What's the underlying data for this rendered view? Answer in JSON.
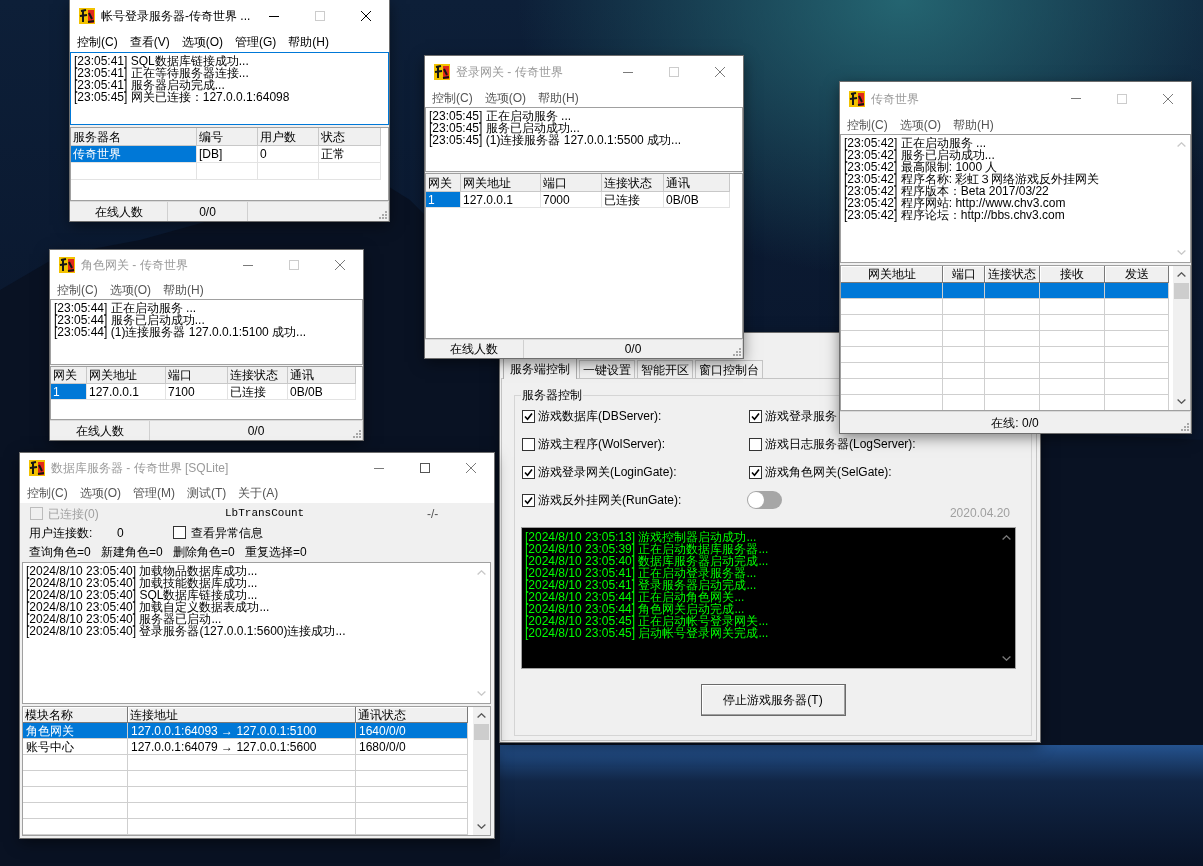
{
  "windows": [
    {
      "kind": "list_window",
      "title": "帐号登录服务器-传奇世界 ...",
      "active": true,
      "maximize_disabled": true,
      "menu": [
        "控制(C)",
        "查看(V)",
        "选项(O)",
        "管理(G)",
        "帮助(H)"
      ],
      "log_focused": true,
      "log": [
        "[23:05:41] SQL数据库链接成功...",
        "[23:05:41] 正在等待服务器连接...",
        "[23:05:41] 服务器启动完成...",
        "[23:05:45] 网关已连接：127.0.0.1:64098"
      ],
      "table": {
        "columns": [
          "服务器名",
          "编号",
          "用户数",
          "状态"
        ],
        "rows": [
          {
            "cells": [
              "传奇世界",
              "[DB]",
              "0",
              "正常"
            ],
            "selected": true
          }
        ]
      },
      "status_bar": [
        "在线人数",
        "0/0"
      ]
    },
    {
      "kind": "list_window",
      "title": "登录网关 - 传奇世界",
      "active": false,
      "maximize_disabled": true,
      "menu": [
        "控制(C)",
        "选项(O)",
        "帮助(H)"
      ],
      "log_focused": false,
      "log": [
        "[23:05:45] 正在启动服务 ...",
        "[23:05:45] 服务已启动成功...",
        "[23:05:45] (1)连接服务器 127.0.0.1:5500 成功..."
      ],
      "table": {
        "columns": [
          "网关",
          "网关地址",
          "端口",
          "连接状态",
          "通讯"
        ],
        "rows": [
          {
            "cells": [
              "1",
              "127.0.0.1",
              "7000",
              "已连接",
              "0B/0B"
            ],
            "selected": true
          }
        ]
      },
      "status_bar": [
        "在线人数",
        "0/0"
      ]
    },
    {
      "kind": "grid_window",
      "title": "传奇世界",
      "active": false,
      "maximize_disabled": true,
      "menu": [
        "控制(C)",
        "选项(O)",
        "帮助(H)"
      ],
      "log_focused": false,
      "log": [
        "[23:05:42] 正在启动服务 ...",
        "[23:05:42] 服务已启动成功...",
        "[23:05:42] 最高限制: 1000 人",
        "[23:05:42] 程序名称: 彩虹３网络游戏反外挂网关",
        "[23:05:42] 程序版本：Beta 2017/03/22",
        "[23:05:42] 程序网站: http://www.chv3.com",
        "[23:05:42] 程序论坛：http://bbs.chv3.com"
      ],
      "table": {
        "columns": [
          "网关地址",
          "端口",
          "连接状态",
          "接收",
          "发送"
        ],
        "rows": [
          {
            "selected": true
          }
        ]
      },
      "status_bar": [
        "在线: 0/0"
      ]
    },
    {
      "kind": "list_window",
      "title": "角色网关 - 传奇世界",
      "active": false,
      "maximize_disabled": true,
      "menu": [
        "控制(C)",
        "选项(O)",
        "帮助(H)"
      ],
      "log_focused": false,
      "log": [
        "[23:05:44] 正在启动服务 ...",
        "[23:05:44] 服务已启动成功...",
        "[23:05:44] (1)连接服务器 127.0.0.1:5100 成功..."
      ],
      "table": {
        "columns": [
          "网关",
          "网关地址",
          "端口",
          "连接状态",
          "通讯"
        ],
        "rows": [
          {
            "cells": [
              "1",
              "127.0.0.1",
              "7100",
              "已连接",
              "0B/0B"
            ],
            "selected": true
          }
        ]
      },
      "status_bar": [
        "在线人数",
        "0/0"
      ]
    },
    {
      "kind": "db_window",
      "title": "数据库服务器 - 传奇世界 [SQLite]",
      "active": false,
      "maximize_disabled": false,
      "menu": [
        "控制(C)",
        "选项(O)",
        "管理(M)",
        "测试(T)",
        "关于(A)"
      ],
      "info": {
        "connected": {
          "label": "已连接(0)",
          "checked": false,
          "disabled": true
        },
        "trans_count": "LbTransCount",
        "ratio": "-/-",
        "user_connections": {
          "label": "用户连接数:",
          "value": "0"
        },
        "show_errors": {
          "label": "查看异常信息",
          "checked": false
        },
        "counters": [
          "查询角色=0",
          "新建角色=0",
          "删除角色=0",
          "重复选择=0"
        ]
      },
      "log_focused": false,
      "log": [
        "[2024/8/10 23:05:40] 加载物品数据库成功...",
        "[2024/8/10 23:05:40] 加载技能数据库成功...",
        "[2024/8/10 23:05:40] SQL数据库链接成功...",
        "[2024/8/10 23:05:40] 加载自定义数据表成功...",
        "[2024/8/10 23:05:40] 服务器已启动...",
        "[2024/8/10 23:05:40] 登录服务器(127.0.0.1:5600)连接成功..."
      ],
      "table": {
        "columns": [
          "模块名称",
          "连接地址",
          "通讯状态"
        ],
        "rows": [
          {
            "cells": [
              "角色网关",
              "127.0.0.1:64093 → 127.0.0.1:5100",
              "1640/0/0"
            ],
            "selected": true
          },
          {
            "cells": [
              "账号中心",
              "127.0.0.1:64079 → 127.0.0.1:5600",
              "1680/0/0"
            ],
            "selected": false
          }
        ]
      }
    },
    {
      "kind": "control_panel",
      "tabs": [
        {
          "label": "服务端控制",
          "selected": true
        },
        {
          "label": "一键设置",
          "selected": false
        },
        {
          "label": "智能开区",
          "selected": false
        },
        {
          "label": "窗口控制台",
          "selected": false
        }
      ],
      "group_title": "服务器控制",
      "servers": [
        {
          "label": "游戏数据库(DBServer):",
          "checked": true
        },
        {
          "label": "游戏登录服务",
          "checked": true
        },
        {
          "label": "游戏主程序(WolServer):",
          "checked": false
        },
        {
          "label": "游戏日志服务器(LogServer):",
          "checked": false
        },
        {
          "label": "游戏登录网关(LoginGate):",
          "checked": true
        },
        {
          "label": "游戏角色网关(SelGate):",
          "checked": true
        },
        {
          "label": "游戏反外挂网关(RunGate):",
          "checked": true
        }
      ],
      "toggle": {
        "on": false
      },
      "version": "2020.04.20",
      "console": [
        "[2024/8/10 23:05:13] 游戏控制器启动成功...",
        "[2024/8/10 23:05:39] 正在启动数据库服务器...",
        "[2024/8/10 23:05:40] 数据库服务器启动完成...",
        "[2024/8/10 23:05:41] 正在启动登录服务器...",
        "[2024/8/10 23:05:41] 登录服务器启动完成...",
        "[2024/8/10 23:05:44] 正在启动角色网关...",
        "[2024/8/10 23:05:44] 角色网关启动完成...",
        "[2024/8/10 23:05:45] 正在启动帐号登录网关...",
        "[2024/8/10 23:05:45] 启动帐号登录网关完成..."
      ],
      "stop_button": "停止游戏服务器(T)"
    }
  ]
}
